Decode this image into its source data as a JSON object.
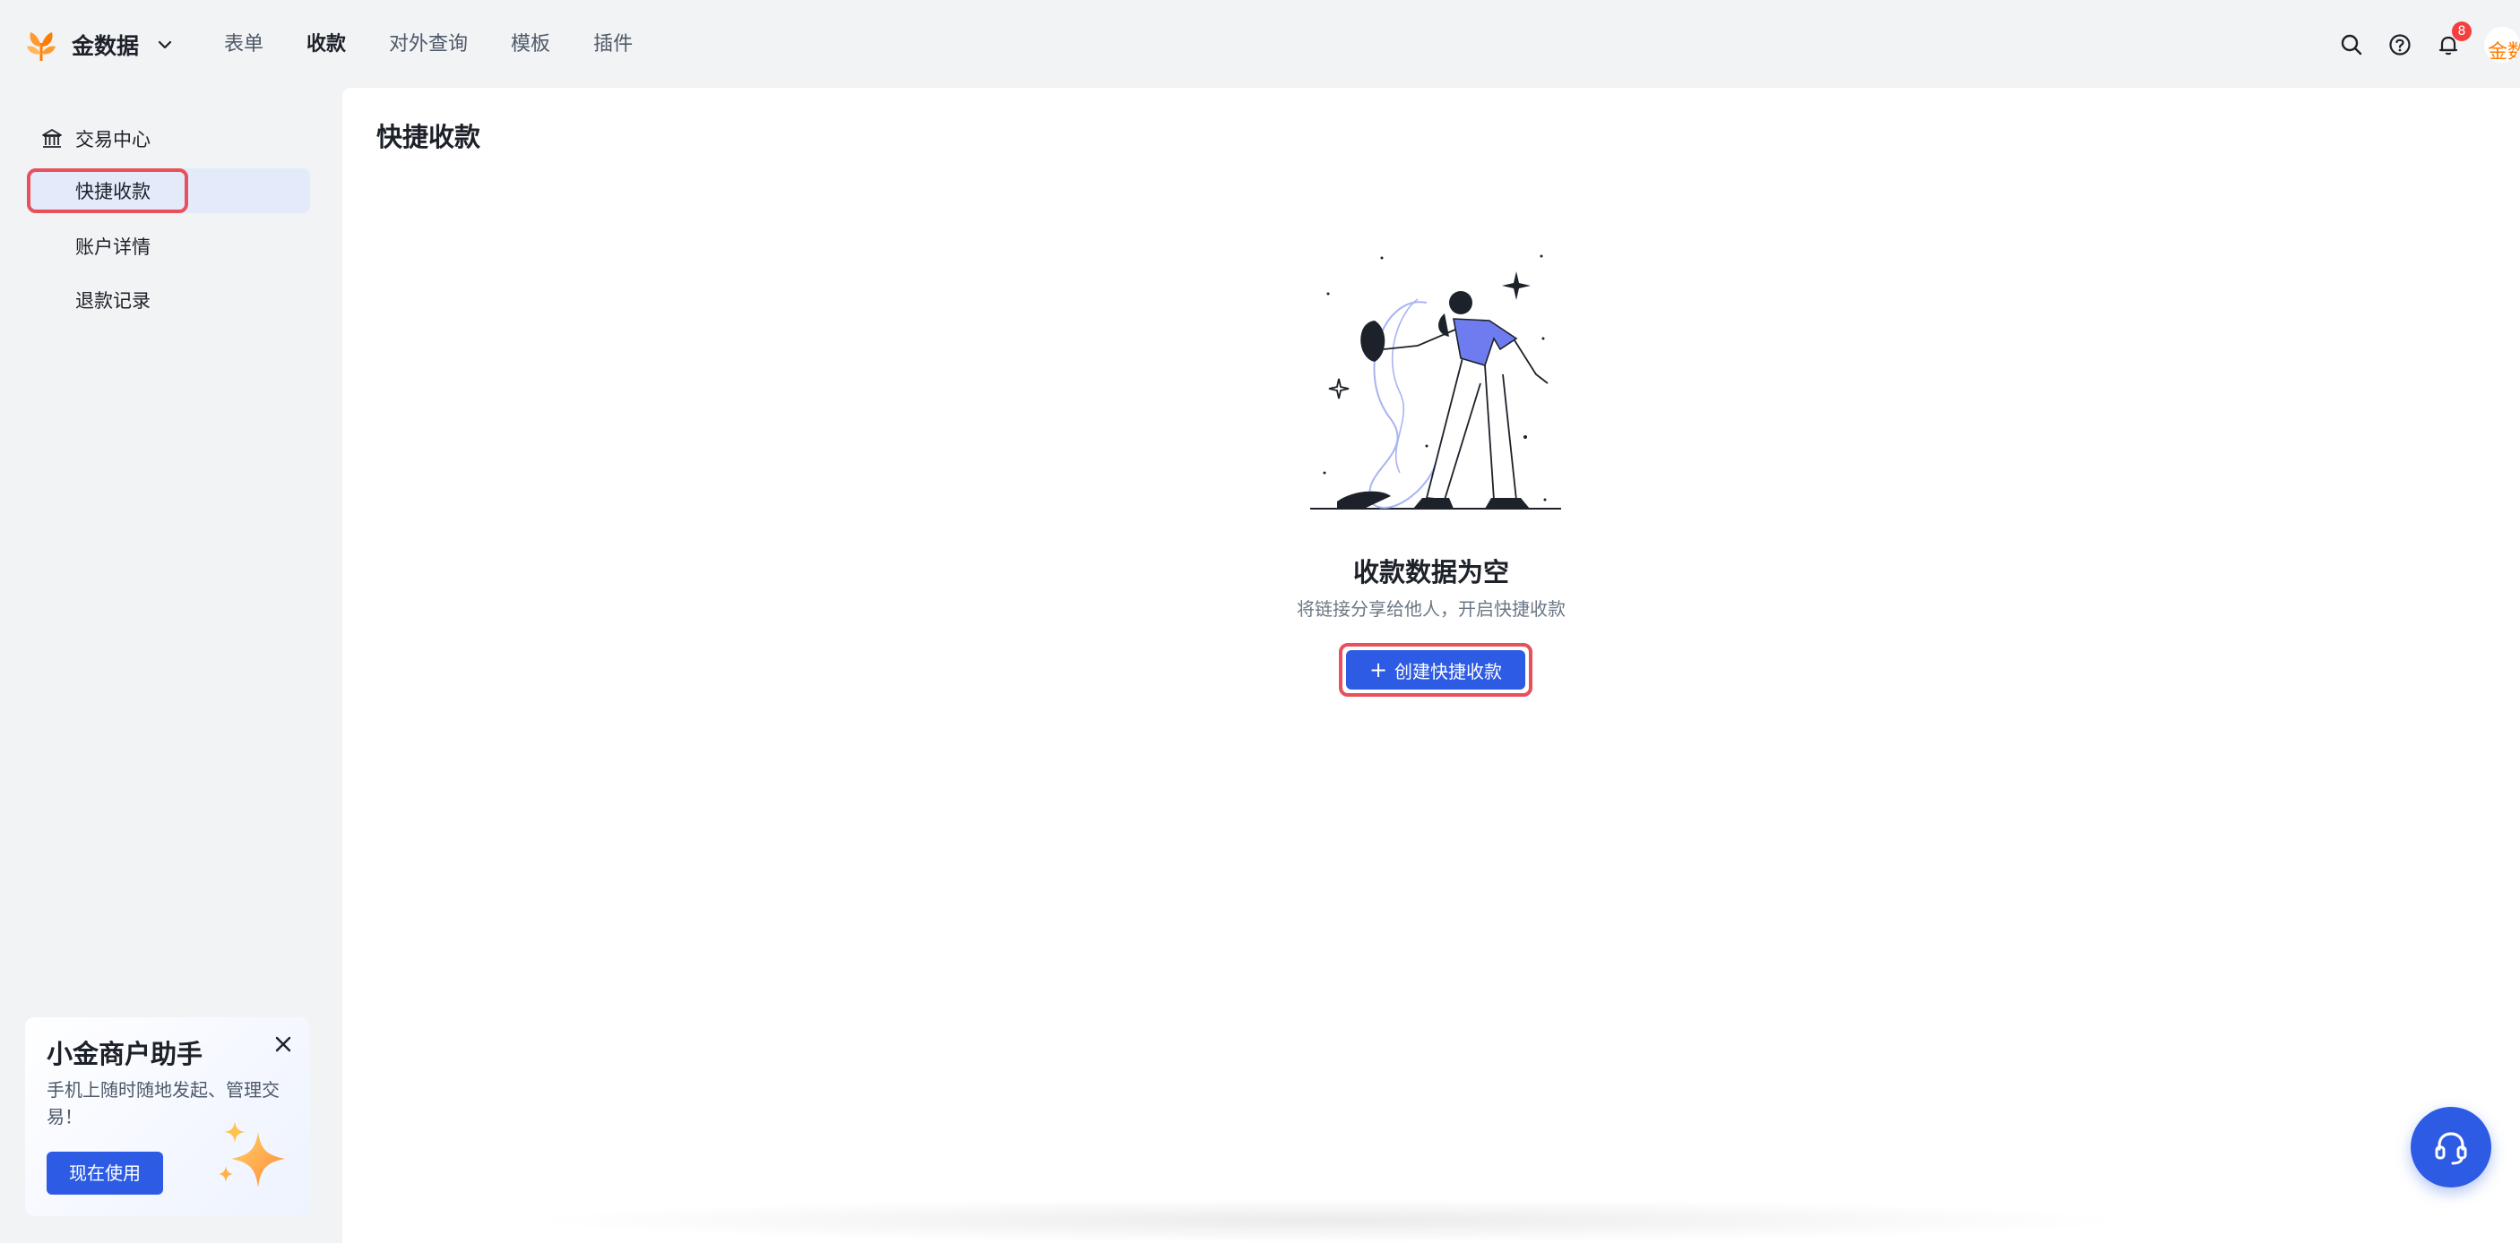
{
  "brand": {
    "name": "金数据",
    "logo_icon": "tree-logo-icon"
  },
  "nav": {
    "items": [
      "表单",
      "收款",
      "对外查询",
      "模板",
      "插件"
    ],
    "active": "收款"
  },
  "header": {
    "icons": [
      "search-icon",
      "help-icon",
      "bell-icon"
    ],
    "notification_count": "8",
    "avatar_text": "金数"
  },
  "sidebar": {
    "group": {
      "label": "交易中心",
      "icon": "bank-icon"
    },
    "items": [
      {
        "label": "快捷收款",
        "selected": true
      },
      {
        "label": "账户详情",
        "selected": false
      },
      {
        "label": "退款记录",
        "selected": false
      }
    ]
  },
  "promo": {
    "title": "小金商户助手",
    "desc": "手机上随时随地发起、管理交易！",
    "button": "现在使用",
    "close_icon": "close-icon",
    "decoration_icon": "sparkle-star-icon"
  },
  "main": {
    "title": "快捷收款",
    "empty_title": "收款数据为空",
    "empty_desc": "将链接分享给他人，开启快捷收款",
    "create_button": "创建快捷收款"
  },
  "colors": {
    "primary": "#2d5be3",
    "highlight": "#e8505b",
    "accent": "#ff7d00",
    "selected_bg": "#e3ebfb"
  },
  "support_icon": "headset-icon"
}
